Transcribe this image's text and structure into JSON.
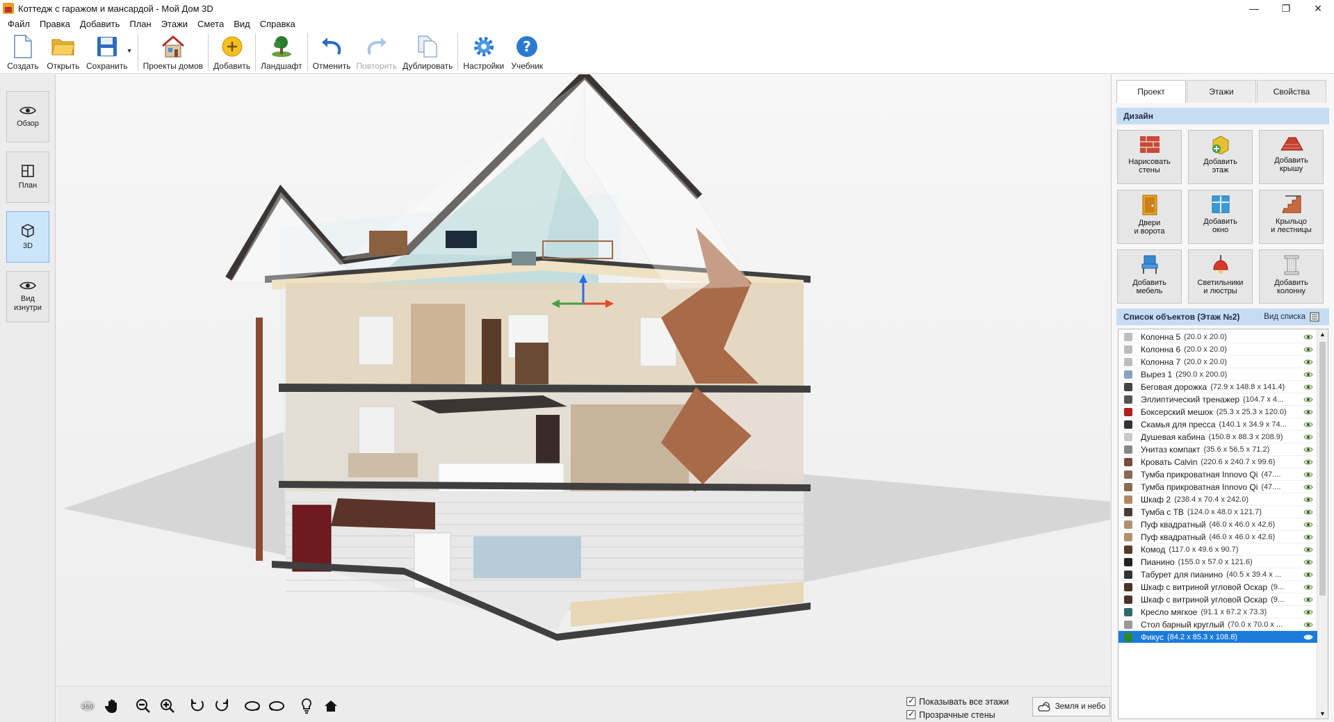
{
  "window": {
    "title": "Коттедж с гаражом и мансардой - Мой Дом 3D",
    "controls": [
      "—",
      "❐",
      "✕"
    ]
  },
  "menu": [
    "Файл",
    "Правка",
    "Добавить",
    "План",
    "Этажи",
    "Смета",
    "Вид",
    "Справка"
  ],
  "toolbar": {
    "create": "Создать",
    "open": "Открыть",
    "save": "Сохранить",
    "projects": "Проекты домов",
    "add": "Добавить",
    "landscape": "Ландшафт",
    "undo": "Отменить",
    "redo": "Повторить",
    "duplicate": "Дублировать",
    "settings": "Настройки",
    "tutorial": "Учебник"
  },
  "views": {
    "overview": "Обзор",
    "plan": "План",
    "three_d": "3D",
    "inside_line1": "Вид",
    "inside_line2": "изнутри",
    "active": "3D"
  },
  "bottom": {
    "show_all_floors": "Показывать все этажи",
    "transparent_walls": "Прозрачные стены",
    "earth_sky": "Земля и небо",
    "show_all_floors_checked": true,
    "transparent_walls_checked": true
  },
  "right": {
    "tabs": [
      "Проект",
      "Этажи",
      "Свойства"
    ],
    "active_tab": "Проект",
    "design_header": "Дизайн",
    "design_buttons": [
      {
        "line1": "Нарисовать",
        "line2": "стены",
        "icon": "brick-wall-icon"
      },
      {
        "line1": "Добавить",
        "line2": "этаж",
        "icon": "add-floor-icon"
      },
      {
        "line1": "Добавить",
        "line2": "крышу",
        "icon": "roof-icon"
      },
      {
        "line1": "Двери",
        "line2": "и ворота",
        "icon": "door-icon"
      },
      {
        "line1": "Добавить",
        "line2": "окно",
        "icon": "window-icon"
      },
      {
        "line1": "Крыльцо",
        "line2": "и лестницы",
        "icon": "stairs-icon"
      },
      {
        "line1": "Добавить",
        "line2": "мебель",
        "icon": "chair-icon"
      },
      {
        "line1": "Светильники",
        "line2": "и люстры",
        "icon": "lamp-icon"
      },
      {
        "line1": "Добавить",
        "line2": "колонну",
        "icon": "column-icon"
      }
    ],
    "objects_header": "Список объектов (Этаж №2)",
    "list_view": "Вид списка",
    "objects": [
      {
        "name": "Колонна 5",
        "dims": "(20.0 x 20.0)",
        "color": "#bdbdbd"
      },
      {
        "name": "Колонна 6",
        "dims": "(20.0 x 20.0)",
        "color": "#bdbdbd"
      },
      {
        "name": "Колонна 7",
        "dims": "(20.0 x 20.0)",
        "color": "#bdbdbd"
      },
      {
        "name": "Вырез 1",
        "dims": "(290.0 x 200.0)",
        "color": "#8aa4c0"
      },
      {
        "name": "Беговая дорожка",
        "dims": "(72.9 x 148.8 x 141.4)",
        "color": "#444444"
      },
      {
        "name": "Эллиптический тренажер",
        "dims": "(104.7 x 4...",
        "color": "#555555"
      },
      {
        "name": "Боксерский мешок",
        "dims": "(25.3 x 25.3 x 120.0)",
        "color": "#b02020"
      },
      {
        "name": "Скамья для пресса",
        "dims": "(140.1 x 34.9 x 74...",
        "color": "#333333"
      },
      {
        "name": "Душевая кабина",
        "dims": "(150.8 x 88.3 x 208.9)",
        "color": "#c9c9c9"
      },
      {
        "name": "Унитаз компакт",
        "dims": "(35.6 x 56.5 x 71.2)",
        "color": "#888888"
      },
      {
        "name": "Кровать Calvin",
        "dims": "(220.6 x 240.7 x 99.6)",
        "color": "#7a4a3a"
      },
      {
        "name": "Тумба прикроватная Innovo Qi",
        "dims": "(47....",
        "color": "#8a6a50"
      },
      {
        "name": "Тумба прикроватная Innovo Qi",
        "dims": "(47....",
        "color": "#8a6a50"
      },
      {
        "name": "Шкаф 2",
        "dims": "(238.4 x 70.4 x 242.0)",
        "color": "#b08a60"
      },
      {
        "name": "Тумба с ТВ",
        "dims": "(124.0 x 48.0 x 121.7)",
        "color": "#4a3a30"
      },
      {
        "name": "Пуф квадратный",
        "dims": "(46.0 x 46.0 x 42.6)",
        "color": "#b09070"
      },
      {
        "name": "Пуф квадратный",
        "dims": "(46.0 x 46.0 x 42.6)",
        "color": "#b09070"
      },
      {
        "name": "Комод",
        "dims": "(117.0 x 49.6 x 90.7)",
        "color": "#5a3a2a"
      },
      {
        "name": "Пианино",
        "dims": "(155.0 x 57.0 x 121.6)",
        "color": "#222222"
      },
      {
        "name": "Табурет для пианино",
        "dims": "(40.5 x 39.4 x ...",
        "color": "#333333"
      },
      {
        "name": "Шкаф с витриной угловой Оскар",
        "dims": "(9...",
        "color": "#4a3426"
      },
      {
        "name": "Шкаф с витриной угловой Оскар",
        "dims": "(9...",
        "color": "#4a3426"
      },
      {
        "name": "Кресло мягкое",
        "dims": "(91.1 x 67.2 x 73.3)",
        "color": "#2e6a6a"
      },
      {
        "name": "Стол барный круглый",
        "dims": "(70.0 x 70.0 x ...",
        "color": "#999999"
      },
      {
        "name": "Фикус",
        "dims": "(84.2 x 85.3 x 108.8)",
        "color": "#2a8a2a",
        "selected": true
      }
    ]
  },
  "colors": {
    "accent": "#1c7bd9",
    "active_view": "#cde5fb",
    "section_header": "#c6dcf0",
    "roof": "#3a3532"
  }
}
